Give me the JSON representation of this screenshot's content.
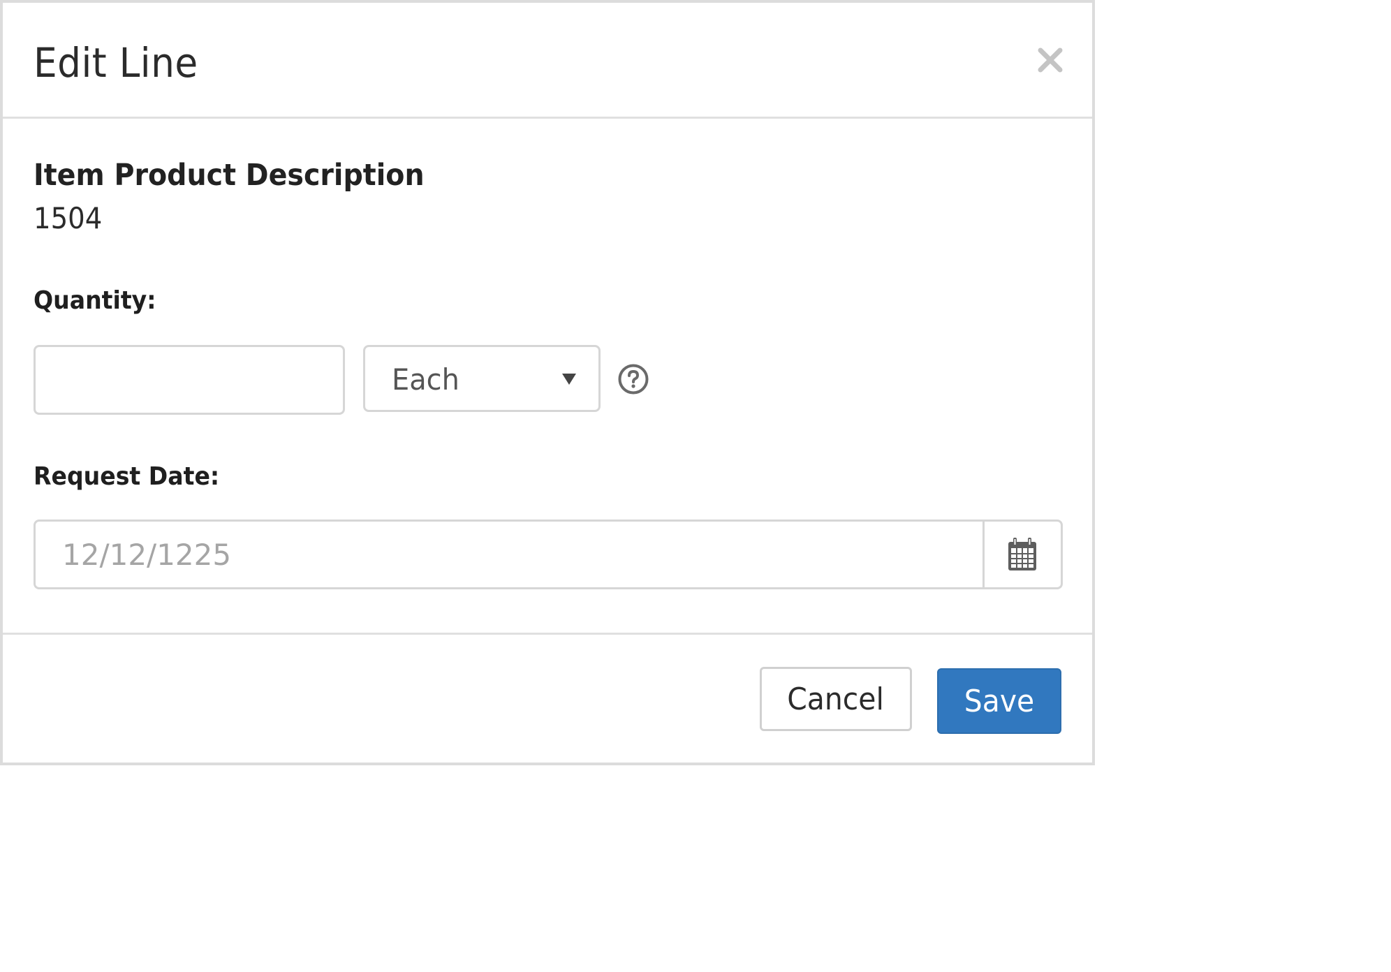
{
  "dialog": {
    "title": "Edit Line",
    "close_icon": "close-icon"
  },
  "item": {
    "label": "Item Product Description",
    "value": "1504"
  },
  "quantity": {
    "label": "Quantity:",
    "value": "",
    "unit_selected": "Each",
    "unit_caret_icon": "caret-down-icon",
    "help_icon": "question-circle-icon"
  },
  "request_date": {
    "label": "Request Date:",
    "value": "",
    "placeholder": "12/12/1225",
    "calendar_icon": "calendar-icon"
  },
  "footer": {
    "cancel_label": "Cancel",
    "save_label": "Save"
  },
  "colors": {
    "primary": "#3178bf",
    "border": "#d6d6d6",
    "text": "#2b2b2b"
  }
}
